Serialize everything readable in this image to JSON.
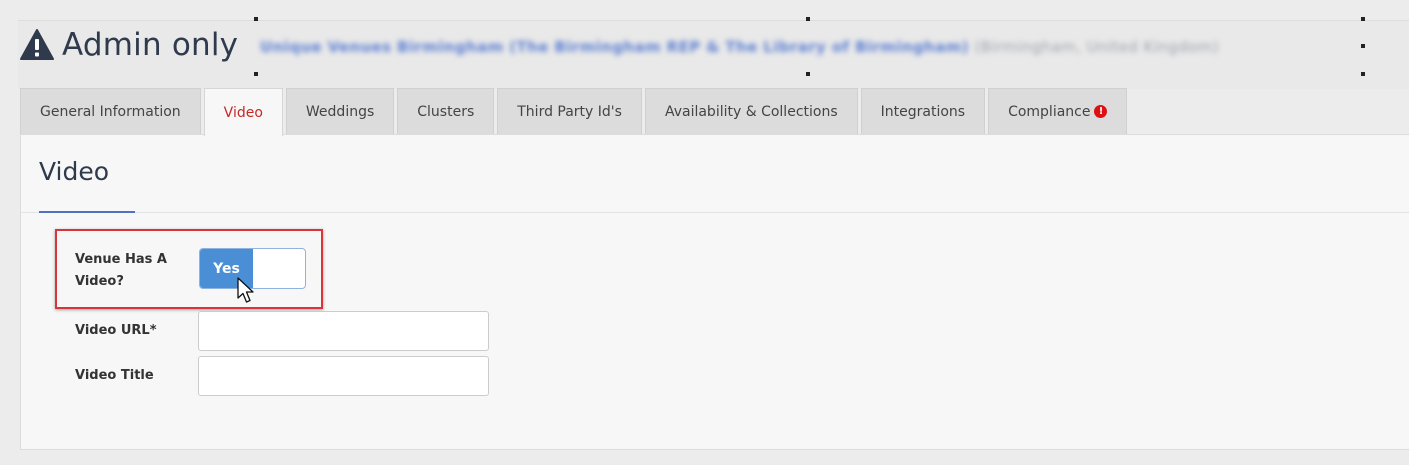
{
  "header": {
    "title": "Admin only",
    "venue_name": "Unique Venues Birmingham (The Birmingham REP & The Library of Birmingham)",
    "venue_location": "(Birmingham, United Kingdom)"
  },
  "tabs": [
    {
      "label": "General Information",
      "active": false
    },
    {
      "label": "Video",
      "active": true
    },
    {
      "label": "Weddings",
      "active": false
    },
    {
      "label": "Clusters",
      "active": false
    },
    {
      "label": "Third Party Id's",
      "active": false
    },
    {
      "label": "Availability & Collections",
      "active": false
    },
    {
      "label": "Integrations",
      "active": false
    },
    {
      "label": "Compliance",
      "active": false,
      "badge": "!"
    }
  ],
  "section": {
    "title": "Video"
  },
  "form": {
    "has_video_label": "Venue Has A Video?",
    "has_video_toggle": "Yes",
    "video_url_label": "Video URL*",
    "video_url_value": "",
    "video_title_label": "Video Title",
    "video_title_value": ""
  },
  "colors": {
    "accent_blue": "#4a8fd6",
    "active_tab_red": "#c62828",
    "highlight_red": "#d9343a"
  }
}
